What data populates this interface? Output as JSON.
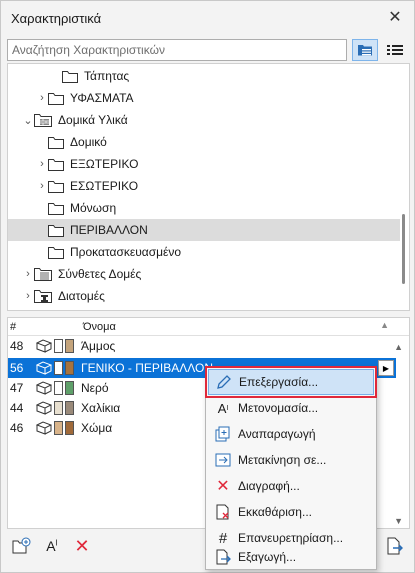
{
  "window": {
    "title": "Χαρακτηριστικά",
    "close_glyph": "✕"
  },
  "search": {
    "placeholder": "Αναζήτηση Χαρακτηριστικών",
    "value": ""
  },
  "tree": {
    "items": [
      {
        "label": "Τάπητας",
        "level": 2,
        "expander": "",
        "icon": "folder-icon"
      },
      {
        "label": "ΥΦΑΣΜΑΤΑ",
        "level": 1,
        "expander": "›",
        "icon": "folder-icon"
      },
      {
        "label": "Δομικά Υλικά",
        "level": 0,
        "expander": "⌄",
        "icon": "building-materials-icon"
      },
      {
        "label": "Δομικό",
        "level": 1,
        "expander": "",
        "icon": "folder-icon"
      },
      {
        "label": "ΕΞΩΤΕΡΙΚΟ",
        "level": 1,
        "expander": "›",
        "icon": "folder-icon"
      },
      {
        "label": "ΕΣΩΤΕΡΙΚΟ",
        "level": 1,
        "expander": "›",
        "icon": "folder-icon"
      },
      {
        "label": "Μόνωση",
        "level": 1,
        "expander": "",
        "icon": "folder-icon"
      },
      {
        "label": "ΠΕΡΙΒΑΛΛΟΝ",
        "level": 1,
        "expander": "",
        "icon": "folder-icon",
        "selected": true
      },
      {
        "label": "Προκατασκευασμένο",
        "level": 1,
        "expander": "",
        "icon": "folder-icon"
      },
      {
        "label": "Σύνθετες Δομές",
        "level": 0,
        "expander": "›",
        "icon": "composite-icon"
      },
      {
        "label": "Διατομές",
        "level": 0,
        "expander": "›",
        "icon": "profile-icon"
      }
    ]
  },
  "table": {
    "headers": {
      "num": "#",
      "name": "Όνομα"
    },
    "rows": [
      {
        "num": "48",
        "name": "Άμμος",
        "swatch": "#c4a47c",
        "selected": false
      },
      {
        "num": "56",
        "name": "ΓΕΝΙΚΟ - ΠΕΡΙΒΑΛΛΟΝ",
        "swatch": "#a6733e",
        "selected": true
      },
      {
        "num": "47",
        "name": "Νερό",
        "swatch": "#5fa06a",
        "selected": false
      },
      {
        "num": "44",
        "name": "Χαλίκια",
        "swatch": "#9a8a7a",
        "selected": false
      },
      {
        "num": "46",
        "name": "Χώμα",
        "swatch": "#a06a3a",
        "selected": false
      }
    ]
  },
  "context_menu": {
    "items": [
      {
        "label": "Επεξεργασία...",
        "icon": "pencil-icon"
      },
      {
        "label": "Μετονομασία...",
        "icon": "rename-icon"
      },
      {
        "label": "Αναπαραγωγή",
        "icon": "duplicate-icon"
      },
      {
        "label": "Μετακίνηση σε...",
        "icon": "move-icon"
      },
      {
        "label": "Διαγραφή...",
        "icon": "delete-icon"
      },
      {
        "label": "Εκκαθάριση...",
        "icon": "purge-icon"
      },
      {
        "label": "Επανευρετηρίαση...",
        "icon": "reindex-icon"
      },
      {
        "label": "Εξαγωγή...",
        "icon": "export-icon"
      }
    ]
  },
  "colors": {
    "selection_blue": "#0b72d7",
    "menu_highlight_border": "#e0283a",
    "tree_selected": "#dcdcdc"
  }
}
